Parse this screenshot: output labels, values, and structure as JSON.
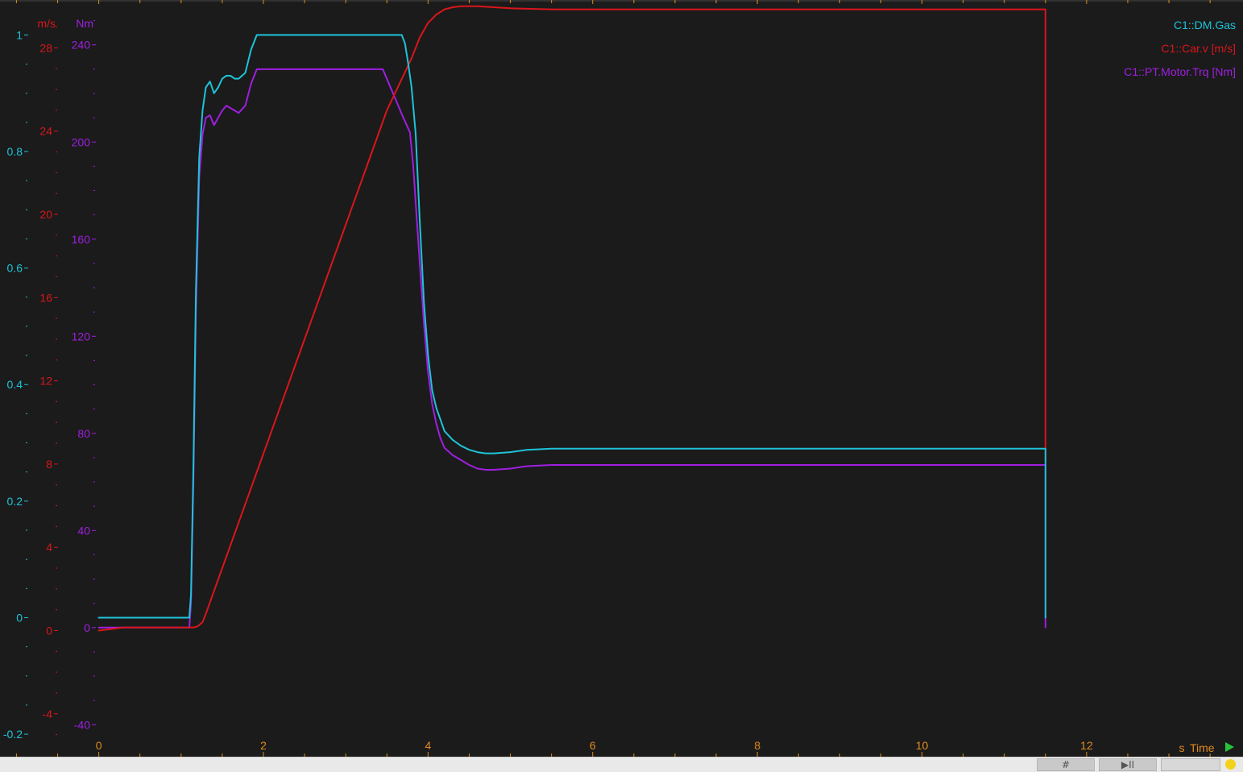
{
  "colors": {
    "background": "#1b1b1b",
    "gas": "#1ec3d8",
    "speed": "#d9161b",
    "torque": "#9f1fe0",
    "time_axis": "#e08a1e",
    "play": "#27c43a",
    "status": "#f2d21b"
  },
  "chart_data": {
    "type": "line",
    "title": "",
    "xlabel": "Time",
    "x_unit": "s",
    "xlim": [
      -1.2,
      13.9
    ],
    "x_ticks": [
      0,
      2,
      4,
      6,
      8,
      10,
      12
    ],
    "x_tick_labels": [
      "0",
      "2",
      "4",
      "6",
      "8",
      "10",
      "12"
    ],
    "grid": false,
    "legend_position": "top-right",
    "axes": [
      {
        "id": "gas",
        "unit": "",
        "ylim": [
          -0.24,
          1.06
        ],
        "ticks": [
          -0.2,
          0,
          0.2,
          0.4,
          0.6,
          0.8,
          1
        ],
        "tick_labels": [
          "-0.2",
          "0",
          "0.2",
          "0.4",
          "0.6",
          "0.8",
          "1"
        ]
      },
      {
        "id": "speed",
        "unit": "m/s",
        "ylim": [
          -6.1,
          30.3
        ],
        "ticks": [
          -4,
          0,
          4,
          8,
          12,
          16,
          20,
          24,
          28
        ],
        "tick_labels": [
          "-4",
          "0",
          "4",
          "8",
          "12",
          "16",
          "20",
          "24",
          "28"
        ]
      },
      {
        "id": "torque",
        "unit": "Nm",
        "ylim": [
          -53.5,
          258.5
        ],
        "ticks": [
          -40,
          0,
          40,
          80,
          120,
          160,
          200,
          240
        ],
        "tick_labels": [
          "-40",
          "0",
          "40",
          "80",
          "120",
          "160",
          "200",
          "240"
        ]
      }
    ],
    "series": [
      {
        "name": "C1::PT.Motor.Trq [Nm]",
        "axis": "torque",
        "x": [
          0,
          1.1,
          1.12,
          1.15,
          1.18,
          1.22,
          1.26,
          1.3,
          1.35,
          1.4,
          1.45,
          1.5,
          1.55,
          1.6,
          1.65,
          1.7,
          1.78,
          1.85,
          1.92,
          2.0,
          3.0,
          3.45,
          3.5,
          3.6,
          3.7,
          3.78,
          3.82,
          3.85,
          3.9,
          3.95,
          4.0,
          4.05,
          4.1,
          4.15,
          4.2,
          4.3,
          4.4,
          4.5,
          4.6,
          4.7,
          4.8,
          5.0,
          5.2,
          5.5,
          6.0,
          8.0,
          10.0,
          11.49,
          11.5,
          11.5
        ],
        "y": [
          0,
          0,
          10,
          60,
          130,
          185,
          203,
          210,
          211,
          207,
          210,
          213,
          215,
          214,
          213,
          212,
          215,
          224,
          230,
          230,
          230,
          230,
          226,
          218,
          210,
          204,
          190,
          175,
          150,
          125,
          105,
          92,
          84,
          78,
          74,
          71,
          69,
          67,
          65.5,
          65,
          65,
          65.5,
          66.5,
          67,
          67,
          67,
          67,
          67,
          67,
          0
        ]
      },
      {
        "name": "C1::Car.v [m/s]",
        "axis": "speed",
        "x": [
          0,
          0.1,
          0.3,
          1.1,
          1.15,
          1.2,
          1.26,
          1.3,
          1.4,
          1.6,
          2.0,
          2.5,
          3.0,
          3.5,
          3.8,
          3.9,
          4.0,
          4.1,
          4.2,
          4.3,
          4.4,
          4.6,
          5.0,
          5.5,
          6.0,
          8.0,
          10.0,
          11.49,
          11.5,
          11.5
        ],
        "y": [
          0,
          0.05,
          0.15,
          0.15,
          0.15,
          0.2,
          0.4,
          0.8,
          1.9,
          4.1,
          8.5,
          14.0,
          19.5,
          25.0,
          27.5,
          28.5,
          29.2,
          29.6,
          29.85,
          29.95,
          30.0,
          30.0,
          29.9,
          29.85,
          29.85,
          29.85,
          29.85,
          29.85,
          29.85,
          8.2
        ]
      },
      {
        "name": "C1::DM.Gas",
        "axis": "gas",
        "x": [
          0,
          1.1,
          1.12,
          1.15,
          1.18,
          1.22,
          1.26,
          1.3,
          1.35,
          1.4,
          1.45,
          1.5,
          1.55,
          1.6,
          1.65,
          1.7,
          1.78,
          1.85,
          1.92,
          2.0,
          3.0,
          3.68,
          3.72,
          3.76,
          3.8,
          3.85,
          3.9,
          3.95,
          4.0,
          4.05,
          4.1,
          4.15,
          4.2,
          4.3,
          4.4,
          4.5,
          4.6,
          4.7,
          4.8,
          5.0,
          5.2,
          5.5,
          6.0,
          8.0,
          10.0,
          11.49,
          11.5,
          11.5
        ],
        "y": [
          0,
          0,
          0.04,
          0.26,
          0.56,
          0.79,
          0.87,
          0.91,
          0.92,
          0.9,
          0.91,
          0.925,
          0.93,
          0.93,
          0.925,
          0.925,
          0.935,
          0.975,
          1.0,
          1.0,
          1.0,
          1.0,
          0.985,
          0.95,
          0.91,
          0.83,
          0.68,
          0.54,
          0.45,
          0.39,
          0.36,
          0.34,
          0.32,
          0.305,
          0.295,
          0.288,
          0.284,
          0.282,
          0.282,
          0.284,
          0.288,
          0.29,
          0.29,
          0.29,
          0.29,
          0.29,
          0.29,
          0
        ]
      }
    ]
  },
  "legend": {
    "gas": "C1::DM.Gas",
    "speed": "C1::Car.v [m/s]",
    "torque": "C1::PT.Motor.Trq [Nm]"
  },
  "time_axis": {
    "unit": "s",
    "label": "Time"
  },
  "toolbar": {
    "grid_icon": "#",
    "play_pause_icon": "▶II"
  },
  "icons": {
    "grid": "grid-icon",
    "play_pause": "play-pause-icon",
    "play": "play-arrow-icon",
    "status": "status-dot-icon"
  }
}
